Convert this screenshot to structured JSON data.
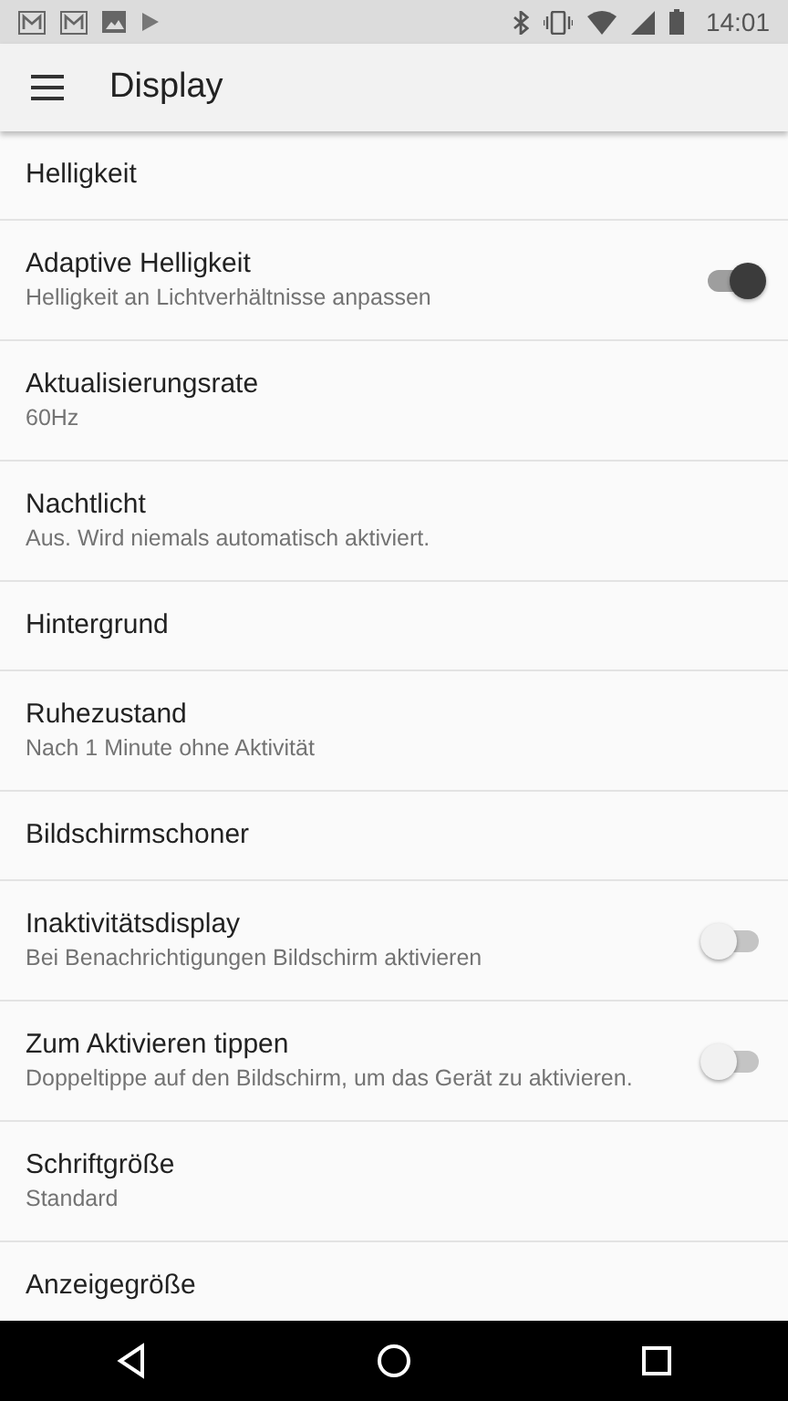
{
  "status_bar": {
    "time": "14:01"
  },
  "app_bar": {
    "title": "Display"
  },
  "settings": [
    {
      "kind": "plain",
      "title": "Helligkeit"
    },
    {
      "kind": "toggle",
      "title": "Adaptive Helligkeit",
      "summary": "Helligkeit an Lichtverhältnisse anpassen",
      "on": true
    },
    {
      "kind": "plain",
      "title": "Aktualisierungsrate",
      "summary": "60Hz"
    },
    {
      "kind": "plain",
      "title": "Nachtlicht",
      "summary": "Aus. Wird niemals automatisch aktiviert."
    },
    {
      "kind": "plain",
      "title": "Hintergrund"
    },
    {
      "kind": "plain",
      "title": "Ruhezustand",
      "summary": "Nach 1 Minute ohne Aktivität"
    },
    {
      "kind": "plain",
      "title": "Bildschirmschoner"
    },
    {
      "kind": "toggle",
      "title": "Inaktivitätsdisplay",
      "summary": "Bei Benachrichtigungen Bildschirm aktivieren",
      "on": false
    },
    {
      "kind": "toggle",
      "title": "Zum Aktivieren tippen",
      "summary": "Doppeltippe auf den Bildschirm, um das Gerät zu aktivieren.",
      "on": false
    },
    {
      "kind": "plain",
      "title": "Schriftgröße",
      "summary": "Standard"
    },
    {
      "kind": "plain",
      "title": "Anzeigegröße"
    }
  ]
}
